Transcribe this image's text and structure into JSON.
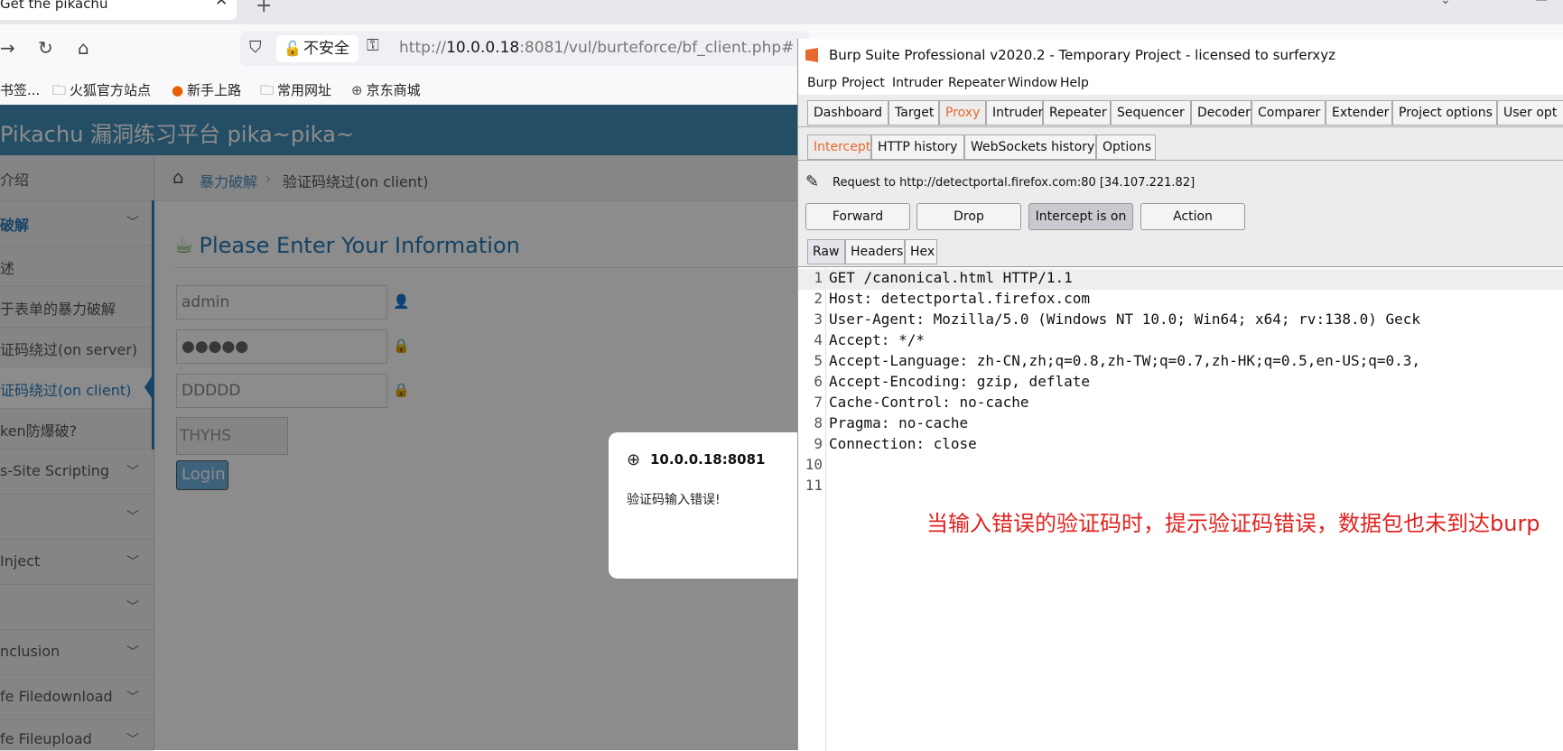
{
  "browser": {
    "tab_title": "Get the pikachu",
    "tab_close": "✕",
    "new_tab": "+",
    "insecure_label": "不安全",
    "url_host": "10.0.0.18",
    "url_prefix": "http://",
    "url_rest": ":8081/vul/burteforce/bf_client.php#",
    "bookmarks": [
      {
        "label": "书签..."
      },
      {
        "label": "火狐官方站点"
      },
      {
        "label": "新手上路"
      },
      {
        "label": "常用网址"
      },
      {
        "label": "京东商城"
      }
    ]
  },
  "pikachu": {
    "brand": "Pikachu 漏洞练习平台 pika~pika~",
    "sidebar": [
      {
        "label": "介绍"
      },
      {
        "label": "破解"
      },
      {
        "label": "述"
      },
      {
        "label": "于表单的暴力破解"
      },
      {
        "label": "证码绕过(on server)"
      },
      {
        "label": "证码绕过(on client)"
      },
      {
        "label": "ken防爆破?"
      },
      {
        "label": "s-Site Scripting"
      },
      {
        "label": ""
      },
      {
        "label": "Inject"
      },
      {
        "label": ""
      },
      {
        "label": "nclusion"
      },
      {
        "label": "fe Filedownload"
      },
      {
        "label": "fe Fileupload"
      }
    ],
    "breadcrumb": {
      "parent": "暴力破解",
      "sep": "›",
      "current": "验证码绕过(on client)"
    },
    "form": {
      "title": "Please Enter Your Information",
      "username_value": "admin",
      "password_value": "●●●●●",
      "captcha_input_value": "DDDDD",
      "captcha_image_text": "THYHS",
      "login_label": "Login"
    }
  },
  "dialog": {
    "host": "10.0.0.18:8081",
    "message": "验证码输入错误!"
  },
  "burp": {
    "title": "Burp Suite Professional v2020.2 - Temporary Project - licensed to surferxyz",
    "menu": [
      "Burp",
      "Project",
      "Intruder",
      "Repeater",
      "Window",
      "Help"
    ],
    "tabs": [
      "Dashboard",
      "Target",
      "Proxy",
      "Intruder",
      "Repeater",
      "Sequencer",
      "Decoder",
      "Comparer",
      "Extender",
      "Project options",
      "User opt"
    ],
    "subtabs": [
      "Intercept",
      "HTTP history",
      "WebSockets history",
      "Options"
    ],
    "request_info": "Request to http://detectportal.firefox.com:80  [34.107.221.82]",
    "buttons": {
      "forward": "Forward",
      "drop": "Drop",
      "intercept": "Intercept is on",
      "action": "Action"
    },
    "view_tabs": [
      "Raw",
      "Headers",
      "Hex"
    ],
    "lines": [
      {
        "n": "1",
        "text": "GET /canonical.html HTTP/1.1"
      },
      {
        "n": "2",
        "text": "Host: detectportal.firefox.com"
      },
      {
        "n": "3",
        "text": "User-Agent: Mozilla/5.0 (Windows NT 10.0; Win64; x64; rv:138.0) Geck"
      },
      {
        "n": "4",
        "text": "Accept: */*"
      },
      {
        "n": "5",
        "text": "Accept-Language: zh-CN,zh;q=0.8,zh-TW;q=0.7,zh-HK;q=0.5,en-US;q=0.3,"
      },
      {
        "n": "6",
        "text": "Accept-Encoding: gzip, deflate"
      },
      {
        "n": "7",
        "text": "Cache-Control: no-cache"
      },
      {
        "n": "8",
        "text": "Pragma: no-cache"
      },
      {
        "n": "9",
        "text": "Connection: close"
      },
      {
        "n": "10",
        "text": ""
      },
      {
        "n": "11",
        "text": ""
      }
    ],
    "annotation": "当输入错误的验证码时，提示验证码错误，数据包也未到达burp"
  },
  "colors": {
    "accent": "#438eb9",
    "burp_orange": "#e8672a",
    "annotation": "#e0221f"
  }
}
